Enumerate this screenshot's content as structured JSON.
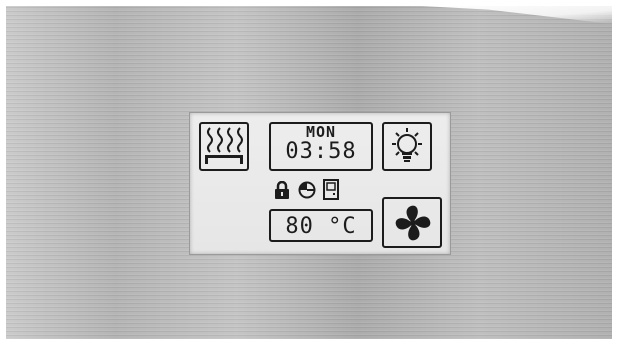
{
  "display": {
    "day": "MON",
    "time": "03:58",
    "temperature": "80 °C"
  },
  "icons": {
    "heater": "sauna-heater-icon",
    "light": "light-bulb-icon",
    "lock": "lock-icon",
    "timer": "timer-icon",
    "door": "door-icon",
    "fan": "fan-icon"
  },
  "colors": {
    "lcd_background": "#e8e8e8",
    "lcd_foreground": "#1c1c1c",
    "panel": "#b8b8b8"
  }
}
